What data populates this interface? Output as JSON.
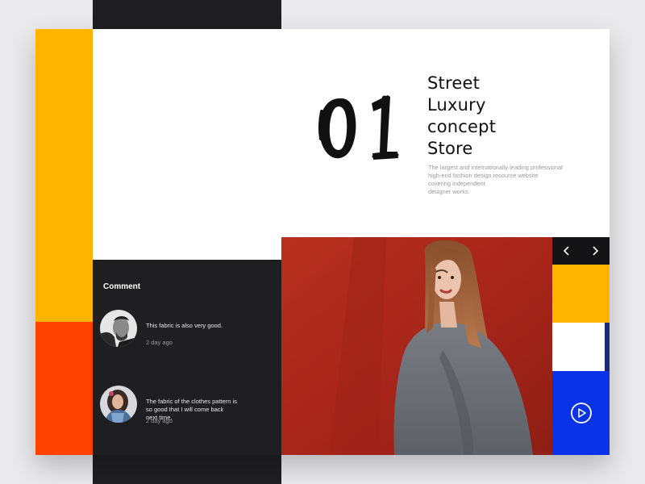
{
  "hero": {
    "number": "01",
    "title_lines": [
      "Street",
      "Luxury",
      "concept",
      "Store"
    ],
    "description_lines": [
      "The largest and internationally leading professional",
      "high-end fashion design resource website",
      "covering independent",
      "designer works."
    ]
  },
  "comments": {
    "heading": "Comment",
    "items": [
      {
        "text_lines": [
          "This fabric is also very good."
        ],
        "time": "2 day ago"
      },
      {
        "text_lines": [
          "The fabric of the clothes pattern is",
          "so good that I will come back",
          "next time."
        ],
        "time": "2 day ago"
      }
    ]
  },
  "icons": {
    "prev": "chevron-left-icon",
    "next": "chevron-right-icon",
    "play": "play-circle-icon"
  },
  "colors": {
    "yellow": "#ffb400",
    "orange": "#ff4200",
    "dark": "#1f1f21",
    "blue": "#0a32e6",
    "photo_red": "#b0281c"
  }
}
